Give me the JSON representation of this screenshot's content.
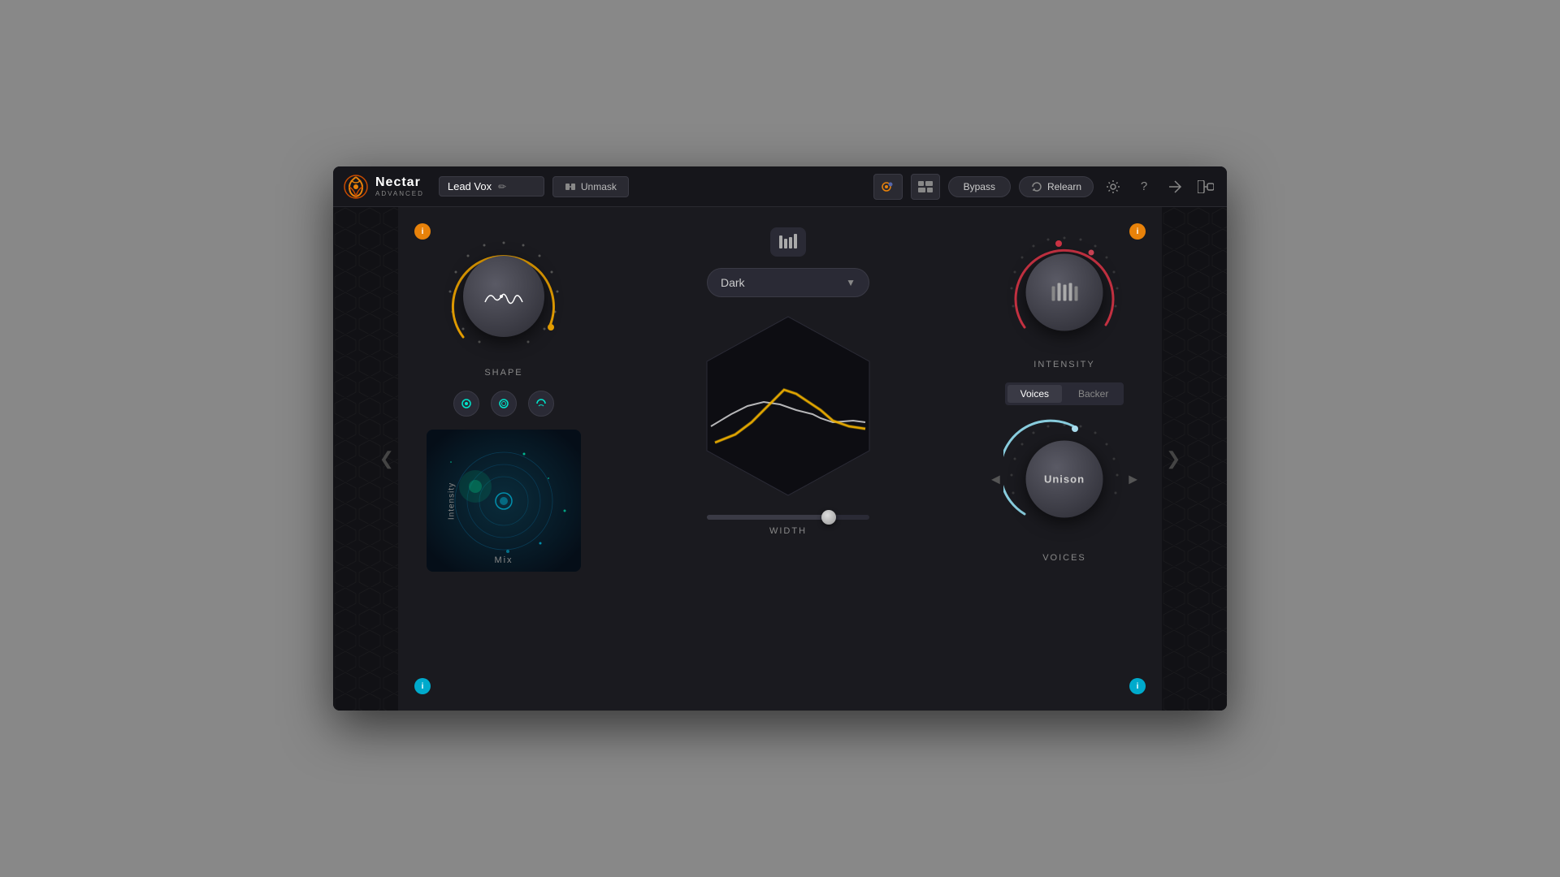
{
  "header": {
    "logo_title": "Nectar",
    "logo_subtitle": "ADVANCED",
    "preset_name": "Lead Vox",
    "unmask_label": "Unmask",
    "bypass_label": "Bypass",
    "relearn_label": "Relearn"
  },
  "main": {
    "shape_label": "SHAPE",
    "style_selected": "Dark",
    "width_label": "WIDTH",
    "intensity_label": "INTENSITY",
    "voices_label": "VOICES",
    "voices_knob_text": "Unison",
    "mix_label": "Mix",
    "mix_intensity": "Intensity",
    "tab_voices": "Voices",
    "tab_backer": "Backer",
    "info_icon": "i"
  }
}
